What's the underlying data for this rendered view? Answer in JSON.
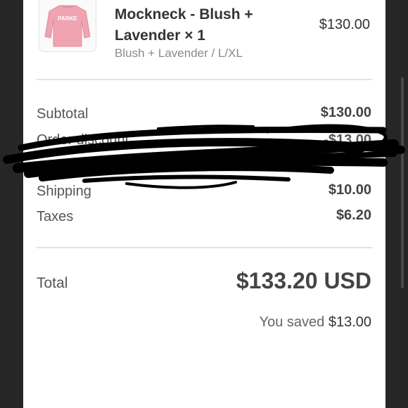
{
  "line_item": {
    "title": "Mockneck - Blush + Lavender × 1",
    "variant": "Blush + Lavender / L/XL",
    "price": "$130.00",
    "thumbnail_text": "PARKE"
  },
  "summary": {
    "subtotal_label": "Subtotal",
    "subtotal_value": "$130.00",
    "order_discount_label": "Order discount",
    "order_discount_value": "-$13.00",
    "shipping_label": "Shipping",
    "shipping_value": "$10.00",
    "taxes_label": "Taxes",
    "taxes_value": "$6.20"
  },
  "total": {
    "label": "Total",
    "value": "$133.20 USD"
  },
  "savings": {
    "prefix": "You saved",
    "amount": "$13.00"
  },
  "colors": {
    "product_pink": "#f0a3b1",
    "redaction_ink": "#000000"
  }
}
